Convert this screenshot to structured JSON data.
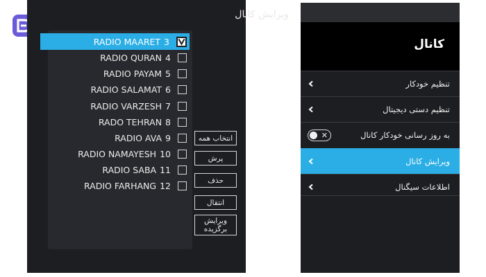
{
  "left_panel": {
    "title": "ویرایش کانال",
    "channels": [
      {
        "number": "3",
        "name": "RADIO MAARET",
        "selected": true
      },
      {
        "number": "4",
        "name": "RADIO QURAN",
        "selected": false
      },
      {
        "number": "5",
        "name": "RADIO PAYAM",
        "selected": false
      },
      {
        "number": "6",
        "name": "RADIO SALAMAT",
        "selected": false
      },
      {
        "number": "7",
        "name": "RADIO VARZESH",
        "selected": false
      },
      {
        "number": "8",
        "name": "RADO TEHRAN",
        "selected": false
      },
      {
        "number": "9",
        "name": "RADIO AVA",
        "selected": false
      },
      {
        "number": "10",
        "name": "RADIO NAMAYESH",
        "selected": false
      },
      {
        "number": "11",
        "name": "RADIO SABA",
        "selected": false
      },
      {
        "number": "12",
        "name": "RADIO FARHANG",
        "selected": false
      }
    ],
    "buttons": {
      "select_all": "انتخاب همه",
      "skip": "پرش",
      "delete": "حذف",
      "move": "انتقال",
      "edit_fav_line1": "ویرایش",
      "edit_fav_line2": "برگزیده"
    }
  },
  "right_panel": {
    "title": "کانال",
    "menu": [
      {
        "label": "تنظیم خودکار"
      },
      {
        "label": "تنظیم دستی دیجیتال"
      },
      {
        "label": "به روز رسانی خودکار کانال",
        "toggle": "off"
      },
      {
        "label": "ویرایش کانال",
        "active": true
      },
      {
        "label": "اطلاعات سیگنال"
      }
    ]
  },
  "colors": {
    "accent": "#2baee5",
    "panel_bg": "#1d1e22",
    "header_bg": "#000000"
  }
}
